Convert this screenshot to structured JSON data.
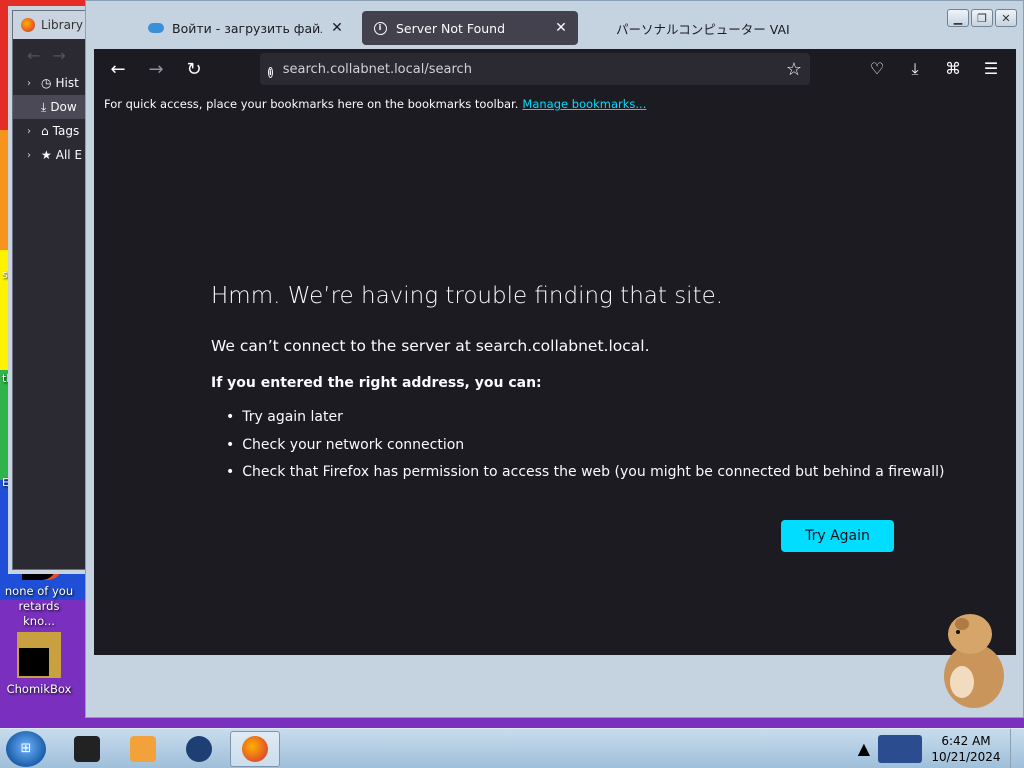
{
  "desktop": {
    "side_labels": [
      "s",
      "th",
      "E"
    ],
    "icons": [
      {
        "label": "none of you retards kno..."
      },
      {
        "label": "ChomikBox"
      }
    ]
  },
  "library": {
    "title": "Library",
    "items": [
      {
        "label": "Hist",
        "icon": "clock-icon"
      },
      {
        "label": "Dow",
        "icon": "download-icon"
      },
      {
        "label": "Tags",
        "icon": "tag-icon"
      },
      {
        "label": "All E",
        "icon": "star-icon"
      }
    ]
  },
  "tabs": [
    {
      "title": "Войти - загрузить файл",
      "icon": "cloud-icon"
    },
    {
      "title": "Server Not Found",
      "icon": "info-icon"
    },
    {
      "title": "パーソナルコンピューター VAI",
      "icon": "none"
    }
  ],
  "urlbar": {
    "url": "search.collabnet.local/search"
  },
  "bookmarks": {
    "hint": "For quick access, place your bookmarks here on the bookmarks toolbar.",
    "manage_link": "Manage bookmarks..."
  },
  "error_page": {
    "title": "Hmm. We’re having trouble finding that site.",
    "subtitle": "We can’t connect to the server at search.collabnet.local.",
    "hint": "If you entered the right address, you can:",
    "suggestions": [
      "Try again later",
      "Check your network connection",
      "Check that Firefox has permission to access the web (you might be connected but behind a firewall)"
    ],
    "button": "Try Again"
  },
  "clock": {
    "time": "6:42 AM",
    "date": "10/21/2024"
  },
  "colors": {
    "content_bg": "#1c1b22",
    "accent": "#00ddff"
  }
}
